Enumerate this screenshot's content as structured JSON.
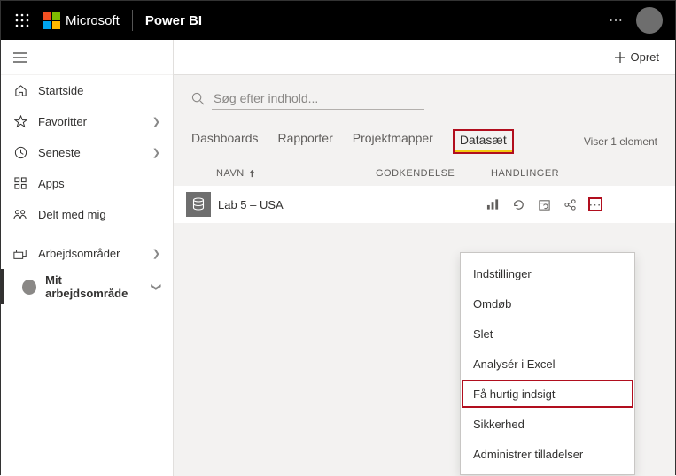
{
  "topbar": {
    "brand": "Microsoft",
    "product": "Power BI"
  },
  "sidebar": {
    "items": [
      {
        "label": "Startside",
        "icon": "home"
      },
      {
        "label": "Favoritter",
        "icon": "star",
        "chevron": true
      },
      {
        "label": "Seneste",
        "icon": "clock",
        "chevron": true
      },
      {
        "label": "Apps",
        "icon": "apps"
      },
      {
        "label": "Delt med mig",
        "icon": "share"
      }
    ],
    "workspaces_label": "Arbejdsområder",
    "current_ws": "Mit arbejdsområde"
  },
  "toolbar": {
    "create": "Opret"
  },
  "search": {
    "placeholder": "Søg efter indhold..."
  },
  "tabs": {
    "items": [
      "Dashboards",
      "Rapporter",
      "Projektmapper",
      "Datasæt"
    ],
    "active_index": 3,
    "count_text": "Viser 1 element"
  },
  "grid": {
    "headers": {
      "name": "NAVN",
      "approval": "GODKENDELSE",
      "actions": "HANDLINGER"
    },
    "rows": [
      {
        "name": "Lab 5 – USA"
      }
    ]
  },
  "context_menu": {
    "items": [
      "Indstillinger",
      "Omdøb",
      "Slet",
      "Analysér i Excel",
      "Få hurtig indsigt",
      "Sikkerhed",
      "Administrer tilladelser"
    ],
    "highlight_index": 4
  }
}
